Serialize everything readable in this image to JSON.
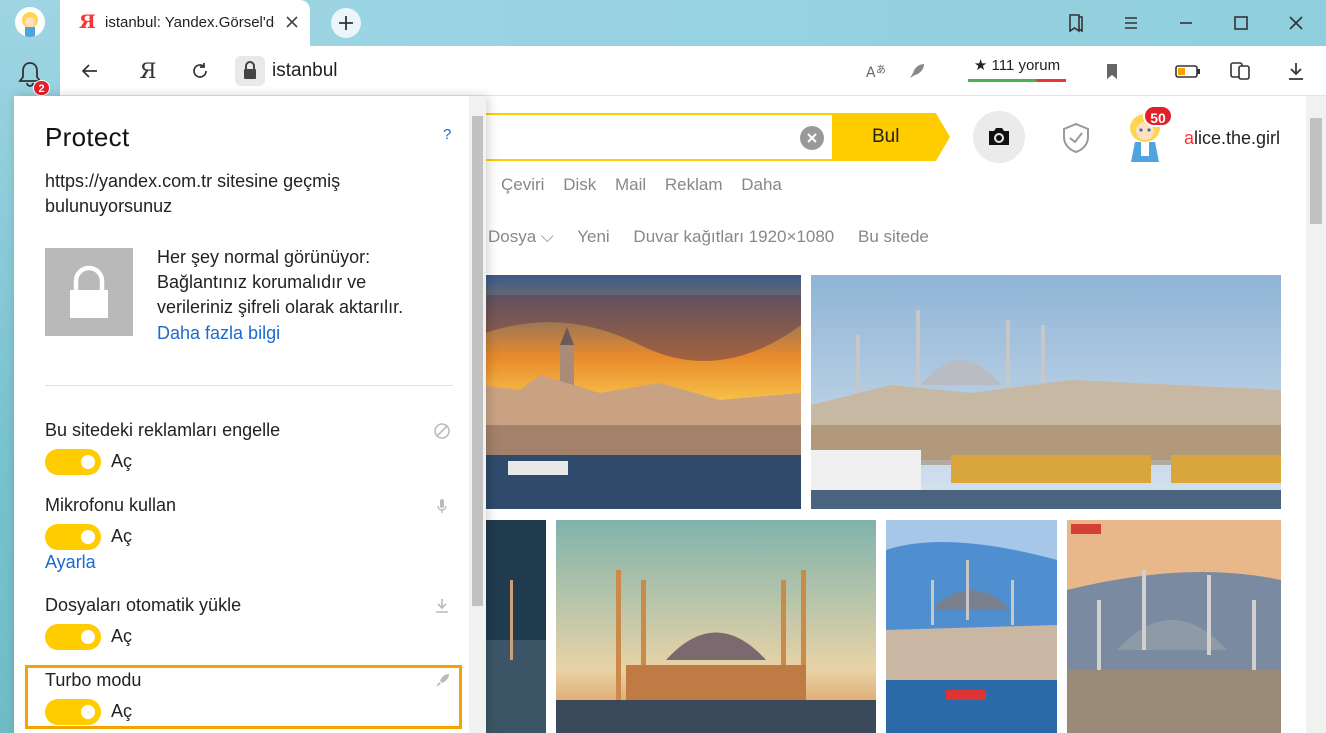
{
  "rail": {
    "notification_count": "2"
  },
  "tab": {
    "favicon": "Я",
    "title": "istanbul: Yandex.Görsel'de"
  },
  "addressbar": {
    "url": "istanbul",
    "yandex_glyph": "Я",
    "rating_label": "★ 111 yorum"
  },
  "page": {
    "search_button": "Bul",
    "user_badge": "50",
    "user_name_first": "a",
    "user_name_rest": "lice.the.girl",
    "services": [
      "Çeviri",
      "Disk",
      "Mail",
      "Reklam",
      "Daha"
    ],
    "filters": [
      "Dosya ⌵",
      "Yeni",
      "Duvar kağıtları 1920×1080",
      "Bu sitede"
    ]
  },
  "panel": {
    "title": "Protect",
    "help": "?",
    "site_text": "https://yandex.com.tr sitesine geçmiş bulunuyorsunuz",
    "status_text": "Her şey normal görünüyor: Bağlantınız korumalıdır ve verileriniz şifreli olarak aktarılır.",
    "more_link": "Daha fazla bilgi",
    "settings": [
      {
        "label": "Bu sitedeki reklamları engelle",
        "state": "Aç",
        "icon": "block-icon"
      },
      {
        "label": "Mikrofonu kullan",
        "state": "Aç",
        "icon": "microphone-icon",
        "link": "Ayarla"
      },
      {
        "label": "Dosyaları otomatik yükle",
        "state": "Aç",
        "icon": "download-icon"
      },
      {
        "label": "Turbo modu",
        "state": "Aç",
        "icon": "rocket-icon"
      }
    ]
  },
  "colors": {
    "accent": "#ffcc00",
    "highlight": "#f5a300",
    "link": "#1a6bd1",
    "badge": "#e0202b"
  }
}
